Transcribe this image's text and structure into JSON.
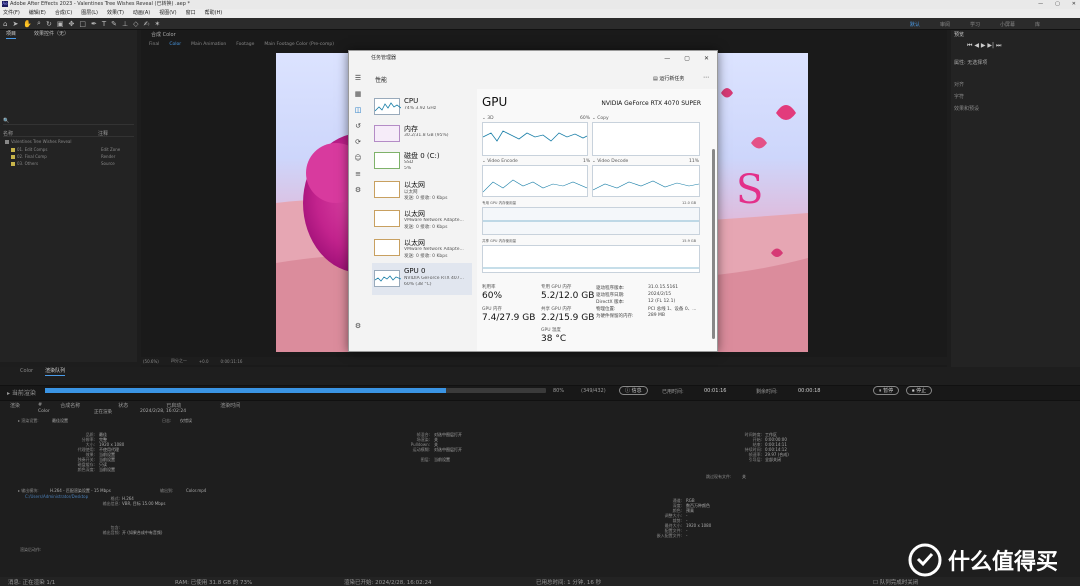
{
  "titlebar": {
    "text": "Adobe After Effects 2023 - Valentines Tree Wishes Reveal (已转换) .aep *",
    "minimize": "—",
    "maximize": "▢",
    "close": "✕"
  },
  "menu": [
    "文件(F)",
    "编辑(E)",
    "合成(C)",
    "图层(L)",
    "效果(T)",
    "动画(A)",
    "视图(V)",
    "窗口",
    "帮助(H)"
  ],
  "workspaces": [
    "默认",
    "审阅",
    "学习",
    "小屏幕",
    "库"
  ],
  "project": {
    "tabs": [
      "项目",
      "效果控件（无）"
    ],
    "search_placeholder": "🔍",
    "col_name": "名称",
    "col_type": "注释",
    "rows": [
      {
        "name": "Valentines Tree Wishes Reveal",
        "type": "",
        "color": "#888888"
      },
      {
        "name": "01. Edit Comps",
        "type": "Edit Zone",
        "color": "#c7b44a"
      },
      {
        "name": "02. Final Comp",
        "type": "Render",
        "color": "#c7b44a"
      },
      {
        "name": "03. Others",
        "type": "Source",
        "color": "#c7b44a"
      }
    ]
  },
  "viewer": {
    "comp_tab": "合成 Color",
    "crumbs": [
      "Final",
      "Color",
      "Main Animation",
      "Footage",
      "Main Footage Color (Pre-comp)"
    ],
    "bar": [
      "(50.6%)",
      "四分之一",
      "+0.0",
      "0:00:11:16"
    ]
  },
  "right_panel": {
    "title": "预览",
    "properties": "属性: 无选择项",
    "items": [
      "对齐",
      "字符",
      "效果和预设"
    ]
  },
  "task_manager": {
    "title": "任务管理器",
    "header": "性能",
    "run_task": "运行新任务",
    "more": "⋯",
    "items": [
      {
        "name": "CPU",
        "sub": "74% 3.92 GHz"
      },
      {
        "name": "内存",
        "sub": "30.2/31.8 GB (95%)"
      },
      {
        "name": "磁盘 0 (C:)",
        "sub": "SSD",
        "sub2": "5%"
      },
      {
        "name": "以太网",
        "sub": "以太网",
        "sub2": "发送: 0 接收: 0 Kbps"
      },
      {
        "name": "以太网",
        "sub": "VMware Network Adapte...",
        "sub2": "发送: 0 接收: 0 Kbps"
      },
      {
        "name": "以太网",
        "sub": "VMware Network Adapte...",
        "sub2": "发送: 0 接收: 0 Kbps"
      },
      {
        "name": "GPU 0",
        "sub": "NVIDIA GeForce RTX 407...",
        "sub2": "60% (38 °C)"
      }
    ],
    "gpu": {
      "title": "GPU",
      "model": "NVIDIA GeForce RTX 4070 SUPER",
      "engines": [
        {
          "name": "3D",
          "pct": "60%"
        },
        {
          "name": "Copy",
          "pct": ""
        },
        {
          "name": "Video Encode",
          "pct": "1%"
        },
        {
          "name": "Video Decode",
          "pct": "11%"
        }
      ],
      "dedicated_label": "专用 GPU 内存使用量",
      "dedicated_max": "12.0 GB",
      "shared_label": "共享 GPU 内存使用量",
      "shared_max": "15.9 GB",
      "stats": [
        {
          "label": "利用率",
          "value": "60%"
        },
        {
          "label": "专用 GPU 内存",
          "value": "5.2/12.0 GB"
        },
        {
          "label": "GPU 内存",
          "value": "7.4/27.9 GB"
        },
        {
          "label": "共享 GPU 内存",
          "value": "2.2/15.9 GB"
        },
        {
          "label": "GPU 温度",
          "value": "38 °C"
        }
      ],
      "info": [
        {
          "k": "驱动程序版本:",
          "v": "31.0.15.5161"
        },
        {
          "k": "驱动程序日期:",
          "v": "2024/2/15"
        },
        {
          "k": "DirectX 版本:",
          "v": "12 (FL 12.1)"
        },
        {
          "k": "物理位置:",
          "v": "PCI 总线 1、设备 0、..."
        },
        {
          "k": "为硬件保留的内存:",
          "v": "289 MB"
        }
      ]
    }
  },
  "render_queue": {
    "tabs": [
      "Color",
      "渲染队列"
    ],
    "current": "当前渲染",
    "progress": 0.8,
    "percent": "80%",
    "frames": "(349/432)",
    "info_btn": "信息",
    "elapsed_label": "已用时间:",
    "elapsed": "00:01:16",
    "remaining_label": "剩余时间:",
    "remaining": "00:00:18",
    "pause_btn": "暂停",
    "stop_btn": "停止",
    "cols": [
      "渲染",
      "#",
      "合成名称",
      "状态",
      "已启动",
      "渲染时间"
    ],
    "job": {
      "name": "Color",
      "status": "正在渲染",
      "started": "2024/2/28, 16:02:24"
    },
    "render_settings_label": "渲染设置:",
    "render_settings": "最佳设置",
    "log_label": "日志:",
    "log": "仅错误",
    "left_details": [
      {
        "k": "品质:",
        "v": "最佳"
      },
      {
        "k": "分辨率:",
        "v": "完整"
      },
      {
        "k": "大小:",
        "v": "1920 x 1080"
      },
      {
        "k": "代理使用:",
        "v": "不使用代理"
      },
      {
        "k": "效果:",
        "v": "当前设置"
      },
      {
        "k": "独奏开关:",
        "v": "当前设置"
      },
      {
        "k": "磁盘缓存:",
        "v": "只读"
      },
      {
        "k": "颜色深度:",
        "v": "当前设置"
      }
    ],
    "mid_details": [
      {
        "k": "帧混合:",
        "v": "对选中图层打开"
      },
      {
        "k": "场渲染:",
        "v": "关"
      },
      {
        "k": "Pulldown:",
        "v": "关"
      },
      {
        "k": "运动模糊:",
        "v": "对选中图层打开"
      },
      {
        "k": "",
        "v": ""
      },
      {
        "k": "图层:",
        "v": "当前设置"
      }
    ],
    "right_details": [
      {
        "k": "时间跨度:",
        "v": "工作区"
      },
      {
        "k": "开始:",
        "v": "0:00:00:00"
      },
      {
        "k": "结束:",
        "v": "0:00:14:11"
      },
      {
        "k": "持续时间:",
        "v": "0:00:14:12"
      },
      {
        "k": "帧速率:",
        "v": "29.97 (合成)"
      },
      {
        "k": "引导层:",
        "v": "全部关闭"
      }
    ],
    "skip_label": "跳过现有文件:",
    "skip": "关",
    "output_module_label": "输出模块:",
    "output_module": "H.264 - 匹配渲染设置 - 15 Mbps",
    "output_to_label": "输出到:",
    "output_to": "Color.mp4",
    "output_path": "C:/Users/Administrator/Desktop",
    "om_left": [
      {
        "k": "格式:",
        "v": "H.264"
      },
      {
        "k": "输出信息:",
        "v": "VBR, 目标 15.00 Mbps"
      }
    ],
    "om_lower": [
      {
        "k": "包含:",
        "v": ""
      },
      {
        "k": "输出音频:",
        "v": "开 (如果合成中有音频)"
      }
    ],
    "om_right": [
      {
        "k": "通道:",
        "v": "RGB"
      },
      {
        "k": "深度:",
        "v": "数百万种颜色"
      },
      {
        "k": "颜色:",
        "v": "预乘"
      },
      {
        "k": "调整大小:",
        "v": "-"
      },
      {
        "k": "裁剪:",
        "v": "-"
      },
      {
        "k": "最终大小:",
        "v": "1920 x 1080"
      },
      {
        "k": "配置文件:",
        "v": "-"
      },
      {
        "k": "嵌入配置文件:",
        "v": "-"
      }
    ],
    "post_render_label": "渲染后动作:"
  },
  "status": {
    "message": "消息: 正在渲染 1/1",
    "ram": "RAM: 已使用 31.8 GB 的 73%",
    "started": "渲染已开始: 2024/2/28, 16:02:24",
    "elapsed": "已用总时间: 1 分钟, 16 秒",
    "checkbox": "队列完成时关闭"
  },
  "watermark": "什么值得买",
  "colors": {
    "accent": "#4a9be8",
    "progress": "#3a94e4",
    "tm_bg": "#f3f3f3",
    "graph_line": "#1a7fa8"
  }
}
